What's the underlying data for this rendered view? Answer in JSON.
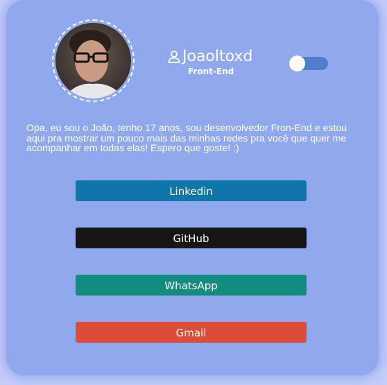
{
  "profile": {
    "avatar_icon": "profile-photo",
    "username": "Joaoltoxd",
    "role": "Front-End",
    "bio": "Opa, eu sou o João, tenho 17 anos, sou desenvolvedor Fron-End e estou aqui pra mostrar um pouco mais das minhas redes pra você que quer me acompanhar em todas elas! Espero que goste! :)"
  },
  "theme_toggle": {
    "state": "off",
    "track_color": "#4d80c8",
    "knob_color": "#ffffff"
  },
  "colors": {
    "card_background": "#8fa8ee",
    "page_background": "#c3cdf9"
  },
  "links": [
    {
      "label": "Linkedin",
      "color": "#0e76a8"
    },
    {
      "label": "GitHub",
      "color": "#171515"
    },
    {
      "label": "WhatsApp",
      "color": "#128c7e"
    },
    {
      "label": "Gmail",
      "color": "#dd4b39"
    }
  ]
}
